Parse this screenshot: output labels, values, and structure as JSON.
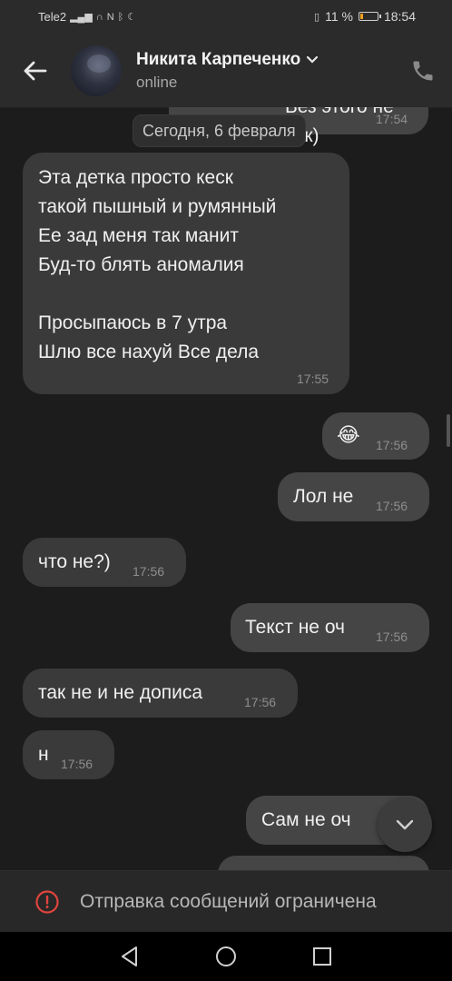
{
  "status_bar": {
    "carrier": "Tele2",
    "battery_text": "11 %",
    "time": "18:54"
  },
  "header": {
    "contact_name": "Никита Карпеченко",
    "status": "online"
  },
  "chat": {
    "date_label": "Сегодня, 6 февраля",
    "messages": [
      {
        "dir": "out",
        "text": "Без этого не как)",
        "time": "17:54"
      },
      {
        "dir": "in",
        "lines": [
          "Эта детка просто кеск",
          "такой пышный и румянный",
          "Ее зад меня так манит",
          "Буд-то блять аномалия",
          "",
          "Просыпаюсь в 7 утра",
          "Шлю все нахуй Все дела"
        ],
        "time": "17:55"
      },
      {
        "dir": "out",
        "text": "😂",
        "time": "17:56"
      },
      {
        "dir": "out",
        "text": "Лол не",
        "time": "17:56"
      },
      {
        "dir": "in",
        "text": "что не?)",
        "time": "17:56"
      },
      {
        "dir": "out",
        "text": "Текст не оч",
        "time": "17:56"
      },
      {
        "dir": "in",
        "text": "так не и не дописа",
        "time": "17:56"
      },
      {
        "dir": "in",
        "text": "н",
        "time": "17:56"
      },
      {
        "dir": "out",
        "text": "Сам не оч",
        "time": ""
      }
    ]
  },
  "restricted_notice": "Отправка сообщений ограничена",
  "colors": {
    "background": "#1c1c1c",
    "incoming_bubble": "#3a3a3a",
    "outgoing_bubble": "#454545",
    "alert_red": "#e0443e"
  }
}
